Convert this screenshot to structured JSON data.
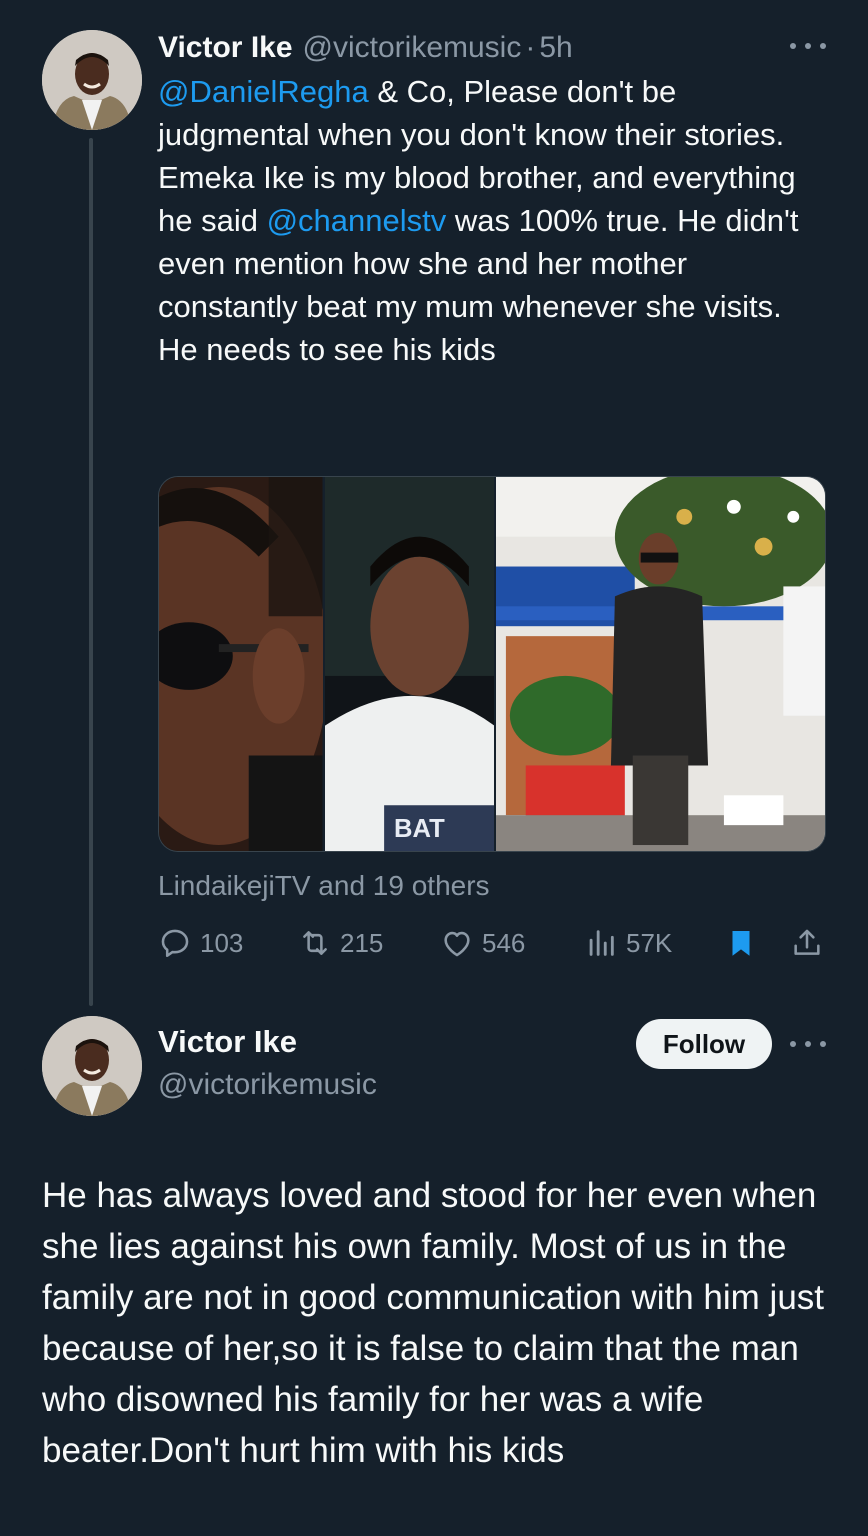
{
  "tweet1": {
    "author_name": "Victor Ike",
    "author_handle": "@victorikemusic",
    "separator": "·",
    "time": "5h",
    "body": {
      "mention1": "@DanielRegha",
      "text1": " & Co, Please don't be judgmental when you don't know their stories.",
      "text2": "Emeka Ike is my blood brother, and everything he said ",
      "mention2": "@channelstv",
      "text3": " was 100% true. He didn't even mention how she and her mother constantly beat my mum whenever she visits. He needs to see his kids"
    },
    "liked_by": "LindaikejiTV and 19 others",
    "stats": {
      "replies": "103",
      "reposts": "215",
      "likes": "546",
      "views": "57K"
    }
  },
  "tweet2": {
    "author_name": "Victor Ike",
    "author_handle": "@victorikemusic",
    "follow_label": "Follow",
    "body": "He has always loved and stood for her even when she lies against his own family. Most of us in the family are not in good communication with him just because of her,so it is false to claim that the man who disowned his family for her was a wife beater.Don't hurt him with his kids"
  },
  "colors": {
    "background": "#15202b",
    "text": "#f7f9f9",
    "secondary": "#8b98a5",
    "accent": "#1d9bf0",
    "bookmark": "#1d9bf0"
  },
  "icons": {
    "reply": "reply-icon",
    "repost": "repost-icon",
    "like": "heart-icon",
    "views": "views-icon",
    "bookmark": "bookmark-icon",
    "share": "share-icon",
    "more": "more-icon"
  }
}
